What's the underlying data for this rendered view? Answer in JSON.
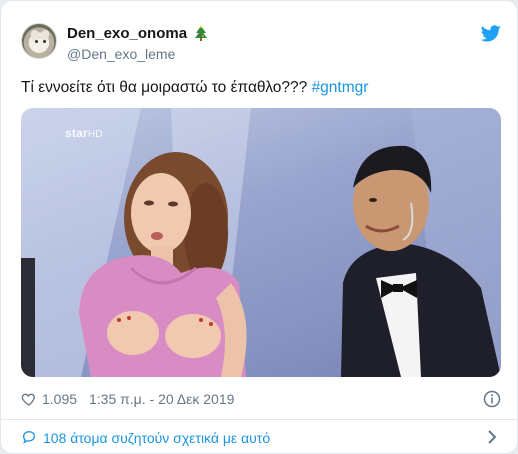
{
  "author": {
    "display_name": "Den_exo_onoma",
    "handle": "@Den_exo_leme",
    "name_emoji_icon": "christmas-tree-icon"
  },
  "tweet": {
    "text_prefix": "Τί εννοείτε ότι θα μοιραστώ το έπαθλο??? ",
    "hashtag": "#gntmgr"
  },
  "media": {
    "watermark": "star",
    "watermark_suffix": "HD"
  },
  "meta": {
    "likes": "1.095",
    "timestamp": "1:35 π.μ. - 20 Δεκ 2019"
  },
  "discussion": {
    "label": "108 άτομα συζητούν σχετικά με αυτό"
  },
  "colors": {
    "link": "#1b95e0",
    "muted": "#657786",
    "twitter_blue": "#1da1f2"
  }
}
